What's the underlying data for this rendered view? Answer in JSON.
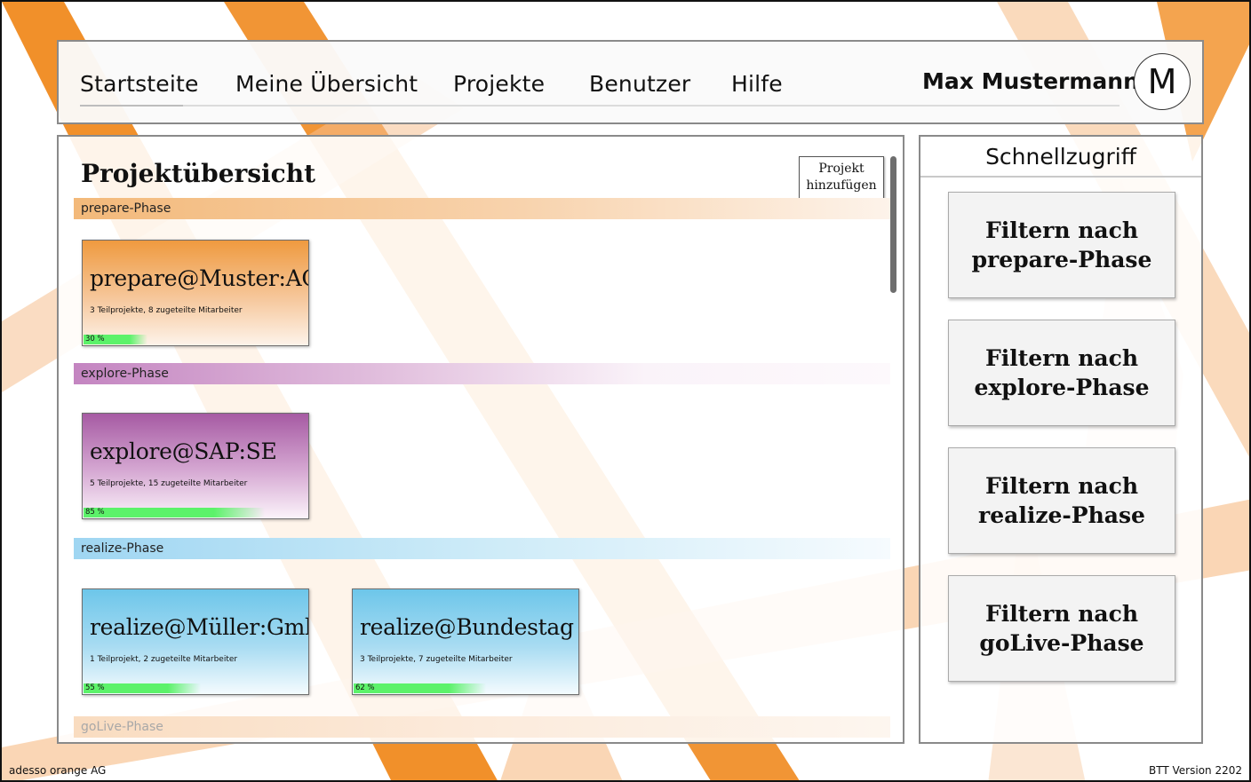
{
  "nav": {
    "items": [
      {
        "label": "Startsteite"
      },
      {
        "label": "Meine Übersicht"
      },
      {
        "label": "Projekte"
      },
      {
        "label": "Benutzer"
      },
      {
        "label": "Hilfe"
      }
    ],
    "user_name": "Max Mustermann",
    "avatar_initial": "M"
  },
  "main": {
    "title": "Projektübersicht",
    "add_button": "Projekt hinzufügen",
    "phases": {
      "prepare": "prepare-Phase",
      "explore": "explore-Phase",
      "realize": "realize-Phase",
      "golive": "goLive-Phase"
    },
    "projects": [
      {
        "title": "prepare@Muster:AG",
        "subtitle": "3 Teilprojekte, 8 zugeteilte Mitarbeiter",
        "progress_label": "30 %",
        "progress": 0.3
      },
      {
        "title": "explore@SAP:SE",
        "subtitle": "5 Teilprojekte, 15 zugeteilte Mitarbeiter",
        "progress_label": "85 %",
        "progress": 0.85
      },
      {
        "title": "realize@Müller:GmbH",
        "subtitle": "1 Teilprojekt, 2 zugeteilte Mitarbeiter",
        "progress_label": "55 %",
        "progress": 0.55
      },
      {
        "title": "realize@Bundestag",
        "subtitle": "3 Teilprojekte, 7 zugeteilte Mitarbeiter",
        "progress_label": "62 %",
        "progress": 0.62
      }
    ]
  },
  "side": {
    "title": "Schnellzugriff",
    "filters": [
      {
        "label": "Filtern nach\nprepare-Phase"
      },
      {
        "label": "Filtern nach\nexplore-Phase"
      },
      {
        "label": "Filtern nach\nrealize-Phase"
      },
      {
        "label": "Filtern nach\ngoLive-Phase"
      }
    ]
  },
  "footer": {
    "left": "adesso orange AG",
    "right": "BTT Version 2202"
  },
  "colors": {
    "accent_orange": "#f08a1f",
    "progress_green": "#5cf26a",
    "prepare": "#ef9a3f",
    "explore": "#a65aa3",
    "realize": "#6dc6ea"
  }
}
